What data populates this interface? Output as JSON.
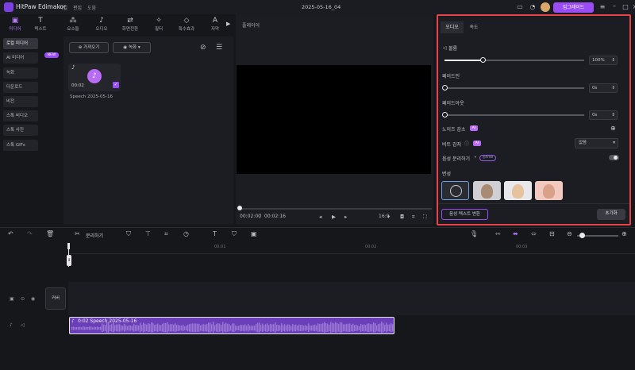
{
  "titlebar": {
    "app_name": "HitPaw Edimakor",
    "menu": [
      "파일",
      "편집",
      "도움"
    ],
    "doc_title": "2025-05-16_04",
    "upgrade_label": "업그레이드"
  },
  "tool_tabs": [
    {
      "label": "미디어",
      "icon": "media-icon",
      "active": true
    },
    {
      "label": "텍스트",
      "icon": "text-icon",
      "active": false
    },
    {
      "label": "요소들",
      "icon": "elements-icon",
      "active": false
    },
    {
      "label": "오디오",
      "icon": "audio-icon",
      "active": false
    },
    {
      "label": "화면전환",
      "icon": "transition-icon",
      "active": false
    },
    {
      "label": "필터",
      "icon": "filter-icon",
      "active": false
    },
    {
      "label": "특수효과",
      "icon": "effects-icon",
      "active": false
    },
    {
      "label": "자막",
      "icon": "subtitle-icon",
      "active": false
    }
  ],
  "sidebar": {
    "items": [
      {
        "label": "로컬 미디어",
        "active": true
      },
      {
        "label": "AI 미디어",
        "active": false
      },
      {
        "label": "녹화",
        "active": false
      },
      {
        "label": "다운로드",
        "active": false
      },
      {
        "label": "비전",
        "active": false
      },
      {
        "label": "스톡 비디오",
        "active": false
      },
      {
        "label": "스톡 사진",
        "active": false
      },
      {
        "label": "스톡 GIFs",
        "active": false
      }
    ],
    "new_badge": "NEW"
  },
  "media_panel": {
    "import_label": "가져오기",
    "record_label": "녹화",
    "item": {
      "duration": "00:02",
      "name": "Speech 2025-05-16"
    }
  },
  "player": {
    "header": "플레이어",
    "current_time": "00:02:00",
    "total_time": "00:02:16",
    "aspect": "16:9"
  },
  "right_panel": {
    "tabs": [
      "오디오",
      "속도"
    ],
    "volume_label": "볼륨",
    "volume_value": "100%",
    "volume_level": 0.27,
    "fade_in_label": "페이드인",
    "fade_in_value": "0s",
    "fade_out_label": "페이드아웃",
    "fade_out_value": "0s",
    "noise_label": "노이즈 감소",
    "beat_label": "비트 감지",
    "beat_value": "없음",
    "separate_label": "음성 분리하기",
    "free_badge": "Free",
    "ai_badge": "AI",
    "voice_section_label": "변성",
    "voice_convert_label": "음성 텍스트 변환",
    "reset_label": "초기화"
  },
  "timeline": {
    "split_label": "분리하기",
    "ruler_marks": [
      "00:01",
      "00:02",
      "00:03"
    ],
    "cover_label": "커버",
    "clip_label": "0:02 Speech 2025-05-16"
  },
  "colors": {
    "accent": "#9b4df5",
    "highlight_border": "#e8424a",
    "clip": "#6a3fb8"
  }
}
